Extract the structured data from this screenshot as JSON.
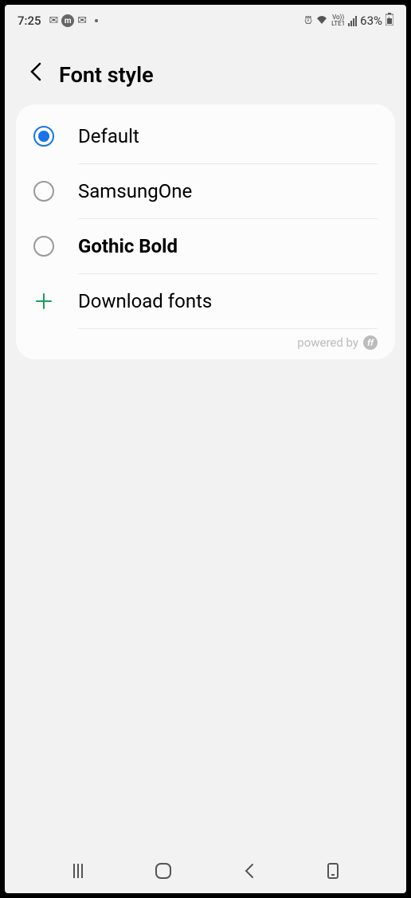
{
  "status": {
    "time": "7:25",
    "battery": "63%",
    "lte_label": "LTE1",
    "vo_label": "Vo))"
  },
  "header": {
    "title": "Font style"
  },
  "options": [
    {
      "label": "Default",
      "selected": true,
      "bold": false
    },
    {
      "label": "SamsungOne",
      "selected": false,
      "bold": false
    },
    {
      "label": "Gothic Bold",
      "selected": false,
      "bold": true
    }
  ],
  "download": {
    "label": "Download fonts"
  },
  "footer": {
    "powered_by": "powered by"
  }
}
